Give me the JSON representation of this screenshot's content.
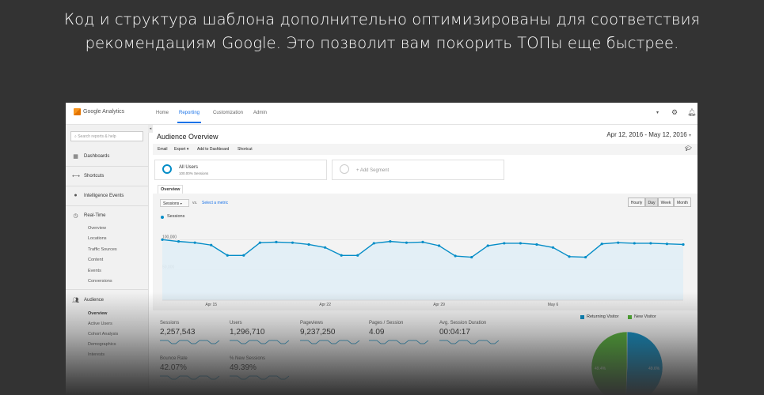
{
  "headline": {
    "line1": "Код и структура шаблона дополнительно оптимизированы для соответствия",
    "line2": "рекомендациям Google. Это позволит вам покорить ТОПы еще быстрее."
  },
  "app": {
    "logo_text": "Google Analytics",
    "tabs": [
      "Home",
      "Reporting",
      "Customization",
      "Admin"
    ],
    "active_tab": "Reporting"
  },
  "sidebar": {
    "search_placeholder": "Search reports & help",
    "items": [
      {
        "label": "Dashboards",
        "icon": "grid-icon"
      },
      {
        "label": "Shortcuts",
        "icon": "arrows-icon"
      },
      {
        "label": "Intelligence Events",
        "icon": "bulb-icon"
      },
      {
        "label": "Real-Time",
        "icon": "clock-icon"
      },
      {
        "label": "Audience",
        "icon": "people-icon"
      }
    ],
    "realtime_sub": [
      "Overview",
      "Locations",
      "Traffic Sources",
      "Content",
      "Events",
      "Conversions"
    ],
    "audience_sub": [
      "Overview",
      "Active Users",
      "Cohort Analysis",
      "Demographics",
      "Interests"
    ]
  },
  "report": {
    "title": "Audience Overview",
    "date_range": "Apr 12, 2016 - May 12, 2016",
    "toolbar": [
      "Email",
      "Export",
      "Add to Dashboard",
      "Shortcut"
    ],
    "segments": {
      "all_users": "All Users",
      "all_users_sub": "100.00% Sessions",
      "add_segment": "+ Add Segment"
    },
    "tab": "Overview",
    "metric_select": "Sessions",
    "vs": "vs.",
    "select_metric": "Select a metric",
    "granularity": [
      "Hourly",
      "Day",
      "Week",
      "Month"
    ],
    "active_granularity": "Day",
    "legend": "Sessions"
  },
  "chart_data": {
    "type": "area",
    "series": [
      {
        "name": "Sessions",
        "values": [
          100000,
          97000,
          95000,
          91000,
          74000,
          74000,
          95000,
          96000,
          95000,
          92000,
          87000,
          74000,
          74000,
          94000,
          97000,
          95000,
          96000,
          90000,
          73000,
          71000,
          90000,
          94000,
          94000,
          92000,
          87000,
          72000,
          71000,
          93000,
          95000,
          94000,
          94000,
          93000,
          92000
        ]
      }
    ],
    "ylim": [
      0,
      120000
    ],
    "yticks": [
      "100,000",
      "50,000"
    ],
    "xticks": [
      "Apr 15",
      "Apr 22",
      "Apr 29",
      "May 6"
    ],
    "colors": {
      "line": "#058dc7",
      "fill": "#e1eef6"
    }
  },
  "metrics": [
    {
      "label": "Sessions",
      "value": "2,257,543"
    },
    {
      "label": "Users",
      "value": "1,296,710"
    },
    {
      "label": "Pageviews",
      "value": "9,237,250"
    },
    {
      "label": "Pages / Session",
      "value": "4.09"
    },
    {
      "label": "Avg. Session Duration",
      "value": "00:04:17"
    },
    {
      "label": "Bounce Rate",
      "value": "42.07%"
    },
    {
      "label": "% New Sessions",
      "value": "49.39%"
    }
  ],
  "pie": {
    "legend": [
      {
        "label": "Returning Visitor",
        "color": "#058dc7"
      },
      {
        "label": "New Visitor",
        "color": "#50b432"
      }
    ],
    "returning_label": "49.6%",
    "new_label": "49.4%",
    "values": [
      50.6,
      49.4
    ]
  }
}
